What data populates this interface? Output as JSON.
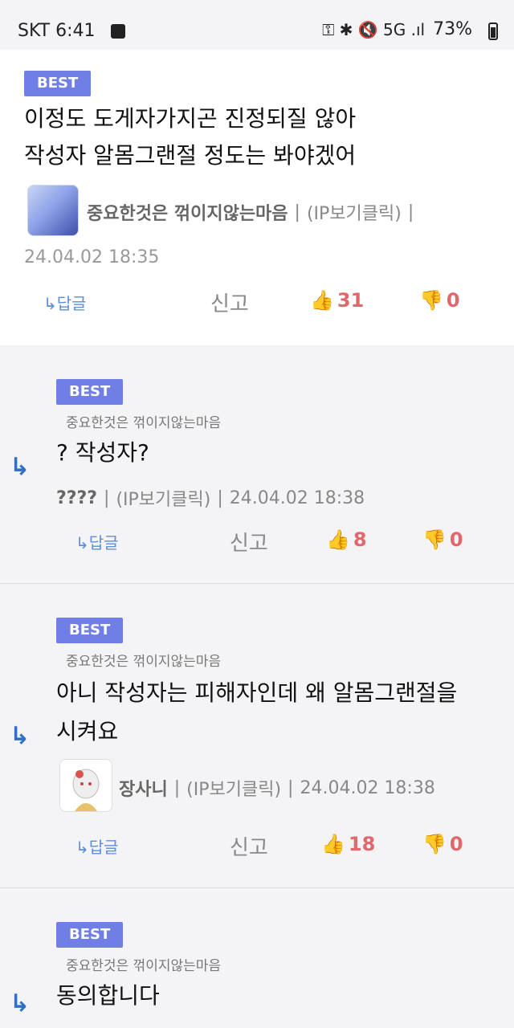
{
  "status": {
    "carrier_time": "SKT 6:41",
    "signal_icons": "⚿ ✱ 🔇 5G .ıl",
    "battery": "73%"
  },
  "comments": [
    {
      "badge": "BEST",
      "text_line1": "이정도 도게자가지곤 진정되질 않아",
      "text_line2": "작성자 알몸그랜절 정도는 봐야겠어",
      "nickname": "중요한것은 꺾이지않는마음",
      "ip": "(IP보기클릭)",
      "date": "24.04.02 18:35",
      "reply_label": "↳답글",
      "report_label": "신고",
      "up": "31",
      "down": "0"
    },
    {
      "badge": "BEST",
      "parent": "중요한것은 꺾이지않는마음",
      "text_line1": "? 작성자?",
      "nickname": "????",
      "ip": "(IP보기클릭)",
      "date": "24.04.02 18:38",
      "reply_label": "↳답글",
      "report_label": "신고",
      "up": "8",
      "down": "0"
    },
    {
      "badge": "BEST",
      "parent": "중요한것은 꺾이지않는마음",
      "text_line1": "아니 작성자는 피해자인데 왜 알몸그랜절을",
      "text_line2": "시켜요",
      "nickname": "장사니",
      "ip": "(IP보기클릭)",
      "date": "24.04.02 18:38",
      "reply_label": "↳답글",
      "report_label": "신고",
      "up": "18",
      "down": "0"
    },
    {
      "badge": "BEST",
      "parent": "중요한것은 꺾이지않는마음",
      "text_line1": "동의합니다"
    }
  ],
  "icons": {
    "reply_arrow": "↳",
    "thumb_up": "👍",
    "thumb_down": "👎"
  },
  "colors": {
    "badge": "#6f7fe6",
    "count": "#e0676b",
    "link": "#5b8ed8"
  }
}
